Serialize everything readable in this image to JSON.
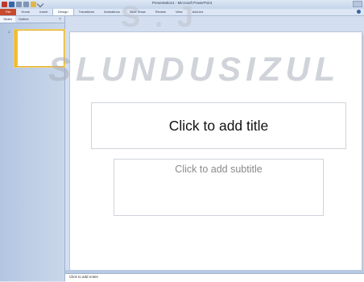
{
  "window": {
    "title": "Presentation1 - Microsoft PowerPoint"
  },
  "ribbon": {
    "tabs": [
      {
        "label": "File"
      },
      {
        "label": "Home"
      },
      {
        "label": "Insert"
      },
      {
        "label": "Design"
      },
      {
        "label": "Transitions"
      },
      {
        "label": "Animations"
      },
      {
        "label": "Slide Show"
      },
      {
        "label": "Review"
      },
      {
        "label": "View"
      },
      {
        "label": "Add-Ins"
      }
    ],
    "active_tab": "Design"
  },
  "left_pane": {
    "tabs": [
      {
        "label": "Slides"
      },
      {
        "label": "Outline"
      }
    ],
    "close_symbol": "×",
    "slides": [
      {
        "number": "1"
      }
    ]
  },
  "slide": {
    "title_placeholder": "Click to add title",
    "subtitle_placeholder": "Click to add subtitle"
  },
  "notes": {
    "placeholder": "Click to add notes"
  },
  "watermark": {
    "line1": "S . J",
    "line2": "SLUNDUSIZUL"
  },
  "colors": {
    "file_tab": "#c74a2b",
    "pane_bg": "#b3c6e1",
    "selection": "#f2c131"
  }
}
